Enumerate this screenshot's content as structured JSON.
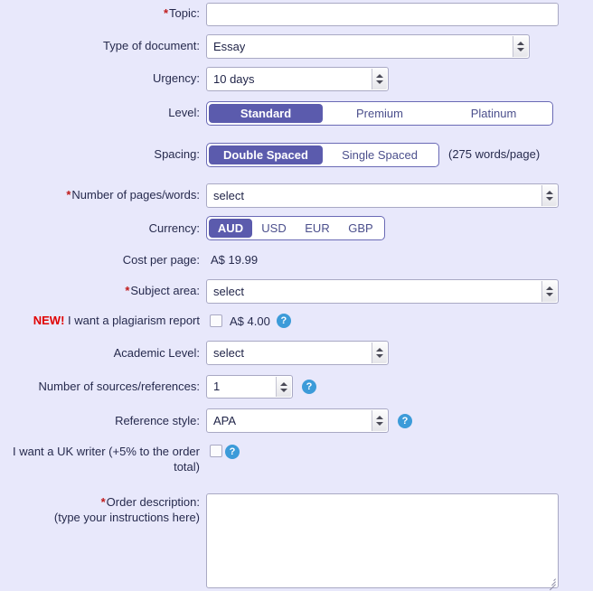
{
  "theme": {
    "page_bg": "#e8e8fb",
    "accent": "#5b5bad",
    "required_star": "#c01a1a",
    "new_badge": "#e00000",
    "help_icon": "#3c9bd9",
    "label_text": "#262a4d",
    "input_border": "#a9a9c4"
  },
  "fields": {
    "topic": {
      "label": "Topic:",
      "required": true,
      "value": "",
      "placeholder": ""
    },
    "type_of_document": {
      "label": "Type of document:",
      "required": false,
      "value": "Essay",
      "control": "select"
    },
    "urgency": {
      "label": "Urgency:",
      "required": false,
      "value": "10 days",
      "control": "select"
    },
    "level": {
      "label": "Level:",
      "required": false,
      "control": "segmented",
      "options": [
        "Standard",
        "Premium",
        "Platinum"
      ],
      "selected": "Standard"
    },
    "spacing": {
      "label": "Spacing:",
      "required": false,
      "control": "segmented",
      "options": [
        "Double Spaced",
        "Single Spaced"
      ],
      "selected": "Double Spaced",
      "note": "(275 words/page)"
    },
    "pages_words": {
      "label": "Number of pages/words:",
      "required": true,
      "value": "select",
      "control": "select"
    },
    "currency": {
      "label": "Currency:",
      "required": false,
      "control": "segmented",
      "options": [
        "AUD",
        "USD",
        "EUR",
        "GBP"
      ],
      "selected": "AUD"
    },
    "cost_per_page": {
      "label": "Cost per page:",
      "required": false,
      "value": "A$ 19.99",
      "control": "static"
    },
    "subject_area": {
      "label": "Subject area:",
      "required": true,
      "value": "select",
      "control": "select"
    },
    "plagiarism_report": {
      "badge": "NEW!",
      "label": "I want a plagiarism report",
      "required": false,
      "control": "checkbox",
      "checked": false,
      "price": "A$ 4.00",
      "help": "?"
    },
    "academic_level": {
      "label": "Academic Level:",
      "required": false,
      "value": "select",
      "control": "select"
    },
    "sources": {
      "label": "Number of sources/references:",
      "required": false,
      "value": "1",
      "control": "number",
      "help": "?"
    },
    "reference_style": {
      "label": "Reference style:",
      "required": false,
      "value": "APA",
      "control": "select",
      "help": "?"
    },
    "uk_writer": {
      "label": "I want a UK writer (+5% to the order total)",
      "required": false,
      "control": "checkbox",
      "checked": false,
      "help": "?"
    },
    "order_description": {
      "label": "Order description:",
      "sublabel": "(type your instructions here)",
      "required": true,
      "value": "",
      "placeholder": "",
      "control": "textarea"
    }
  }
}
